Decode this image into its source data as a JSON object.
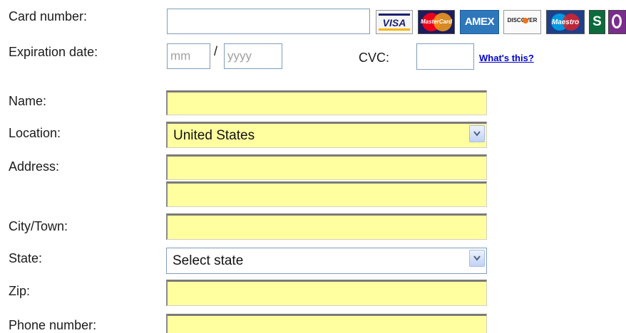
{
  "labels": {
    "card_number": "Card number:",
    "expiration_date": "Expiration date:",
    "cvc": "CVC:",
    "name": "Name:",
    "location": "Location:",
    "address": "Address:",
    "city": "City/Town:",
    "state": "State:",
    "zip": "Zip:",
    "phone": "Phone number:"
  },
  "expiration": {
    "month_placeholder": "mm",
    "separator": "/",
    "year_placeholder": "yyyy"
  },
  "links": {
    "whats_this": "What's this?"
  },
  "selects": {
    "location_value": "United States",
    "state_value": "Select state"
  },
  "card_logos": {
    "visa": "VISA",
    "mastercard": "MasterCard",
    "amex": "AMEX",
    "discover": "DISCOVER",
    "maestro": "Maestro",
    "solo": "S"
  },
  "colors": {
    "field_highlight": "#ffffa0",
    "link": "#0000cc",
    "input_border": "#7f9db9"
  }
}
